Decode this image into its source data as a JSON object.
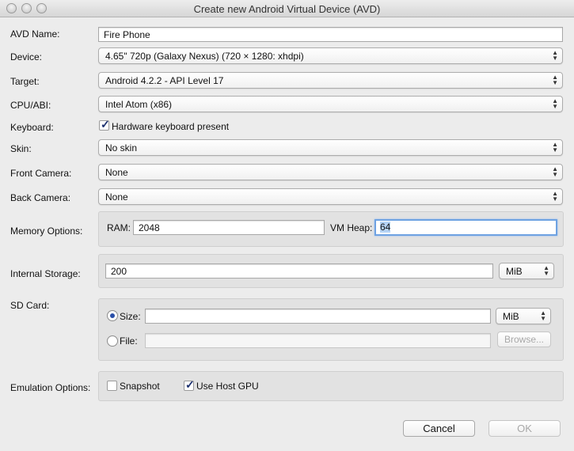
{
  "window": {
    "title": "Create new Android Virtual Device (AVD)"
  },
  "labels": {
    "avd_name": "AVD Name:",
    "device": "Device:",
    "target": "Target:",
    "cpu_abi": "CPU/ABI:",
    "keyboard": "Keyboard:",
    "skin": "Skin:",
    "front_camera": "Front Camera:",
    "back_camera": "Back Camera:",
    "memory_options": "Memory Options:",
    "internal_storage": "Internal Storage:",
    "sd_card": "SD Card:",
    "emulation_options": "Emulation Options:"
  },
  "fields": {
    "avd_name": "Fire Phone",
    "device": "4.65\" 720p (Galaxy Nexus) (720 × 1280: xhdpi)",
    "target": "Android 4.2.2 - API Level 17",
    "cpu_abi": "Intel Atom (x86)",
    "keyboard_label": "Hardware keyboard present",
    "keyboard_checked": true,
    "skin": "No skin",
    "front_camera": "None",
    "back_camera": "None"
  },
  "memory": {
    "ram_label": "RAM:",
    "ram_value": "2048",
    "vm_heap_label": "VM Heap:",
    "vm_heap_value": "64"
  },
  "internal_storage": {
    "value": "200",
    "unit": "MiB"
  },
  "sd_card": {
    "size_label": "Size:",
    "size_value": "",
    "size_unit": "MiB",
    "size_selected": true,
    "file_label": "File:",
    "file_value": "",
    "browse_label": "Browse..."
  },
  "emulation": {
    "snapshot_label": "Snapshot",
    "snapshot_checked": false,
    "host_gpu_label": "Use Host GPU",
    "host_gpu_checked": true
  },
  "buttons": {
    "cancel": "Cancel",
    "ok": "OK"
  }
}
